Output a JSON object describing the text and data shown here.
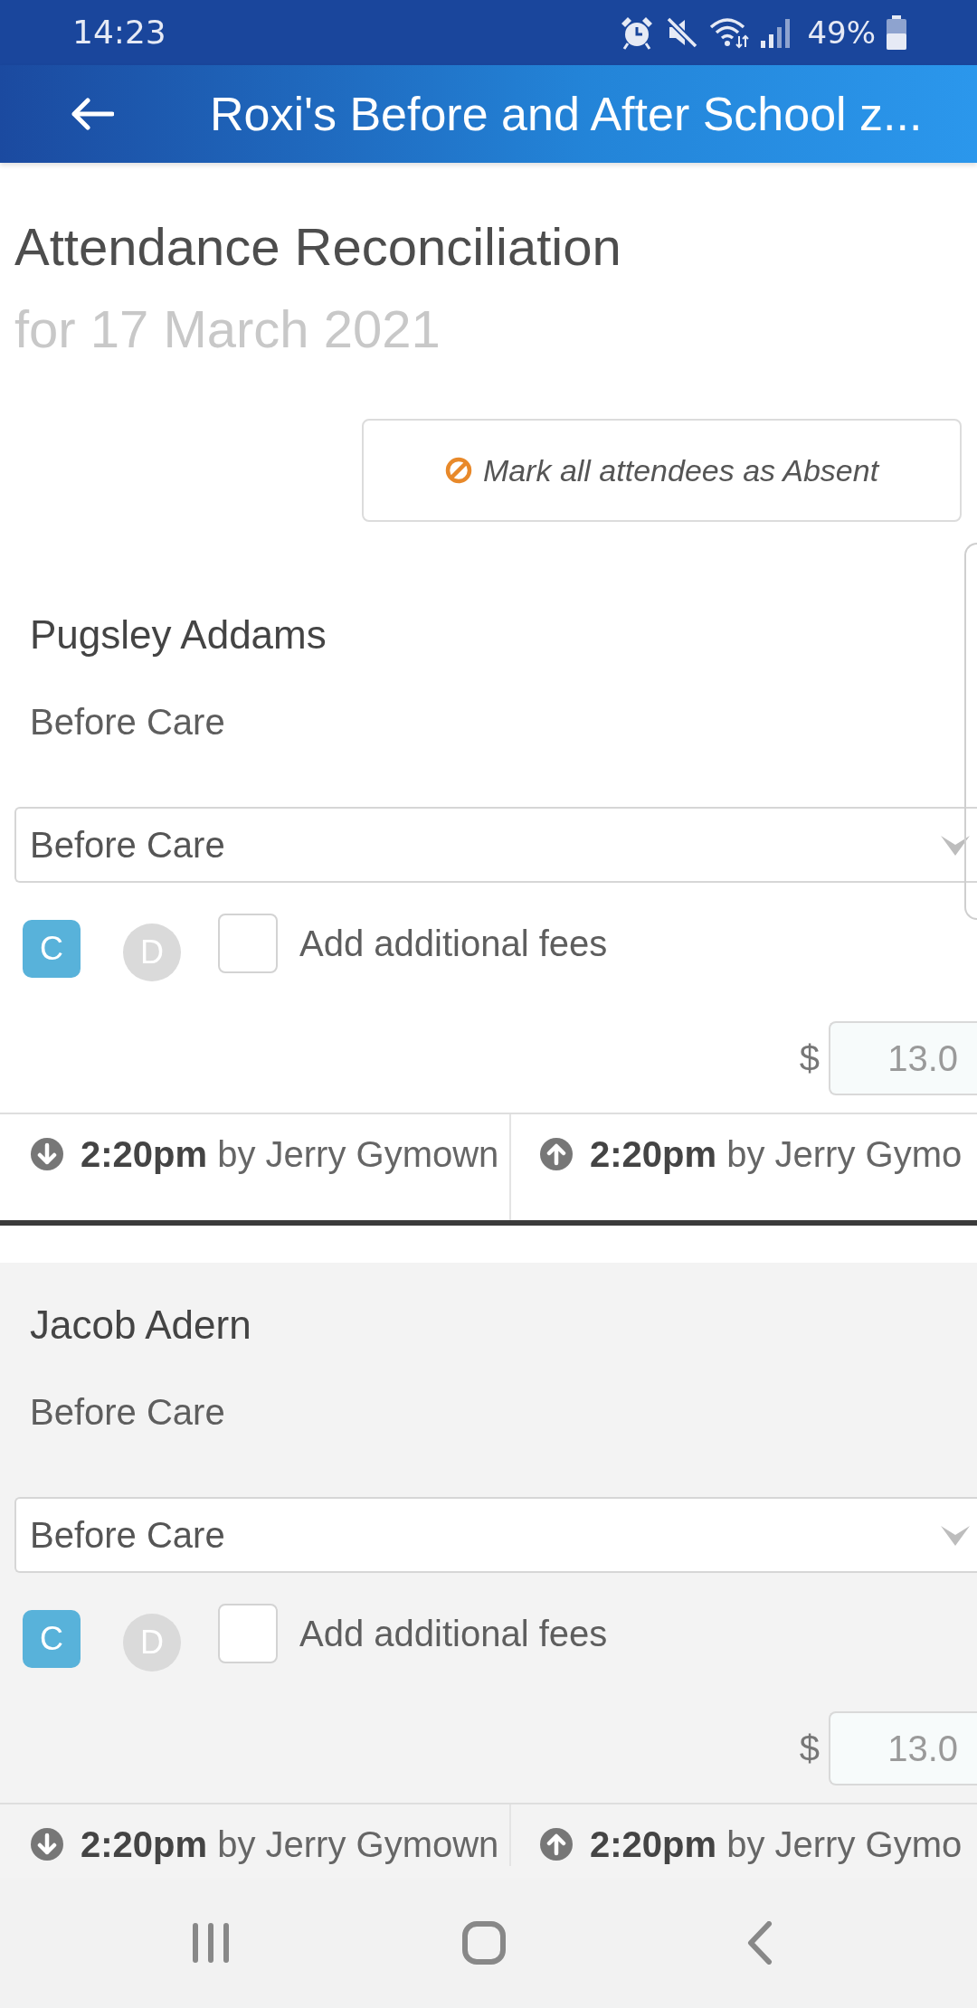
{
  "status_bar": {
    "time": "14:23",
    "battery": "49%"
  },
  "header": {
    "title": "Roxi's Before and After School z..."
  },
  "page": {
    "title": "Attendance Reconciliation",
    "subtitle": "for 17 March 2021",
    "mark_absent_button": "Mark all attendees as Absent"
  },
  "attendees": [
    {
      "name": "Pugsley Addams",
      "session": "Before Care",
      "session_select": "Before Care",
      "options": [
        {
          "label": "C",
          "selected": true
        },
        {
          "label": "D",
          "selected": false
        }
      ],
      "additional_fees": {
        "label": "Add additional fees",
        "checked": false
      },
      "amount": {
        "currency": "$",
        "value": "13.0"
      },
      "events": [
        {
          "kind": "in",
          "text": "**2:20pm** by Jerry Gymown"
        },
        {
          "kind": "out",
          "text": "**2:20pm** by Jerry Gymo"
        }
      ]
    },
    {
      "name": "Jacob Adern",
      "session": "Before Care",
      "session_select": "Before Care",
      "options": [
        {
          "label": "C",
          "selected": true
        },
        {
          "label": "D",
          "selected": false
        }
      ],
      "additional_fees": {
        "label": "Add additional fees",
        "checked": false
      },
      "amount": {
        "currency": "$",
        "value": "13.0"
      },
      "events": [
        {
          "kind": "in",
          "text": "**2:20pm** by Jerry Gymown"
        },
        {
          "kind": "out",
          "text": "**2:20pm** by Jerry Gymo"
        }
      ]
    }
  ]
}
